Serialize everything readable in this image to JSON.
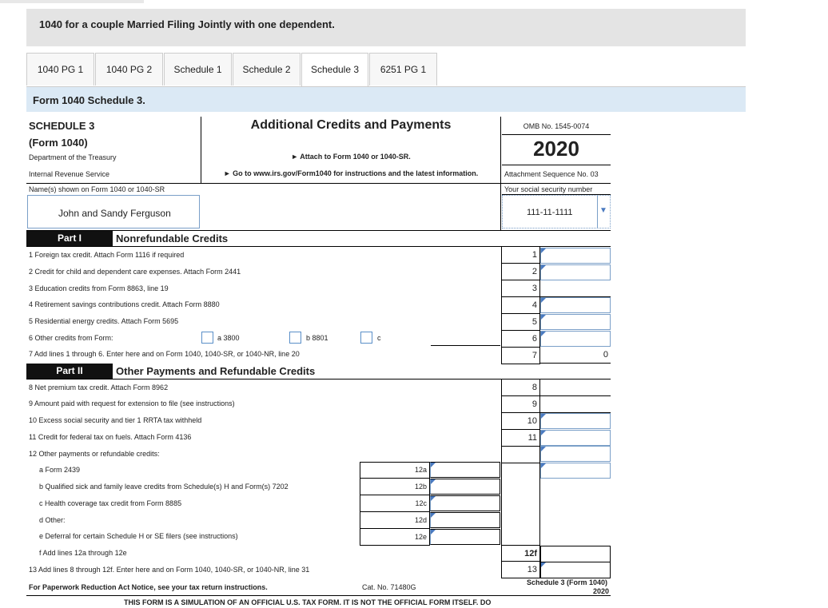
{
  "banner": "1040 for a couple Married Filing Jointly with one dependent.",
  "tabs": [
    "1040 PG 1",
    "1040 PG 2",
    "Schedule 1",
    "Schedule 2",
    "Schedule 3",
    "6251 PG 1"
  ],
  "active_tab": "Schedule 3",
  "subheader": "Form 1040 Schedule 3.",
  "form": {
    "schedule": "SCHEDULE 3",
    "form_ref": "(Form 1040)",
    "dept": "Department of the Treasury",
    "irs": "Internal Revenue Service",
    "title": "Additional Credits and Payments",
    "attach": "► Attach to Form 1040 or 1040-SR.",
    "goto": "► Go to www.irs.gov/Form1040 for instructions and the latest information.",
    "omb": "OMB No. 1545-0074",
    "year": "2020",
    "seq": "Attachment Sequence No. 03",
    "name_label": "Name(s) shown on Form 1040 or 1040-SR",
    "name_value": "John and Sandy Ferguson",
    "ssn_label": "Your social security number",
    "ssn_value": "111-11-1111"
  },
  "part1": {
    "tag": "Part I",
    "title": "Nonrefundable Credits",
    "lines": [
      {
        "num": "1",
        "text": "1 Foreign tax credit. Attach Form 1116 if required",
        "value": ""
      },
      {
        "num": "2",
        "text": "2 Credit for child and dependent care expenses. Attach Form 2441",
        "value": ""
      },
      {
        "num": "3",
        "text": "3 Education credits from Form 8863, line 19",
        "value": ""
      },
      {
        "num": "4",
        "text": "4 Retirement savings contributions credit. Attach Form 8880",
        "value": ""
      },
      {
        "num": "5",
        "text": "5 Residential energy credits. Attach Form 5695",
        "value": ""
      },
      {
        "num": "6",
        "text": "6 Other credits from Form:",
        "value": ""
      },
      {
        "num": "7",
        "text": "7 Add lines 1 through 6. Enter here and on Form 1040, 1040-SR, or 1040-NR, line 20",
        "value": "0"
      }
    ],
    "checkboxes": [
      "a 3800",
      "b 8801",
      "c"
    ]
  },
  "part2": {
    "tag": "Part II",
    "title": "Other Payments and Refundable Credits",
    "lines": [
      {
        "num": "8",
        "text": "8 Net premium tax credit. Attach Form 8962",
        "value": ""
      },
      {
        "num": "9",
        "text": "9 Amount paid with request for extension to file (see instructions)",
        "value": ""
      },
      {
        "num": "10",
        "text": "10 Excess social security and tier 1 RRTA tax withheld",
        "value": ""
      },
      {
        "num": "11",
        "text": "11 Credit for federal tax on fuels. Attach Form 4136",
        "value": ""
      },
      {
        "num": "",
        "text": "12 Other payments or refundable credits:",
        "value": ""
      }
    ],
    "sublines": [
      {
        "num": "12a",
        "text": "a Form 2439"
      },
      {
        "num": "12b",
        "text": "b Qualified sick and family leave credits from Schedule(s) H and Form(s) 7202"
      },
      {
        "num": "12c",
        "text": "c Health coverage tax credit from Form 8885"
      },
      {
        "num": "12d",
        "text": "d Other:"
      },
      {
        "num": "12e",
        "text": "e Deferral for certain Schedule H or SE filers (see instructions)"
      }
    ],
    "line12f": {
      "num": "12f",
      "text": "f Add lines 12a through 12e"
    },
    "line13": {
      "num": "13",
      "text": "13 Add lines 8 through 12f. Enter here and on Form 1040, 1040-SR, or 1040-NR, line 31"
    }
  },
  "footer": {
    "notice": "For Paperwork Reduction Act Notice, see your tax return instructions.",
    "cat": "Cat. No. 71480G",
    "formref": "Schedule 3 (Form 1040)",
    "formyear": "2020",
    "disclaimer": "THIS FORM IS A SIMULATION OF AN OFFICIAL U.S. TAX FORM. IT IS NOT THE OFFICIAL FORM ITSELF. DO"
  }
}
